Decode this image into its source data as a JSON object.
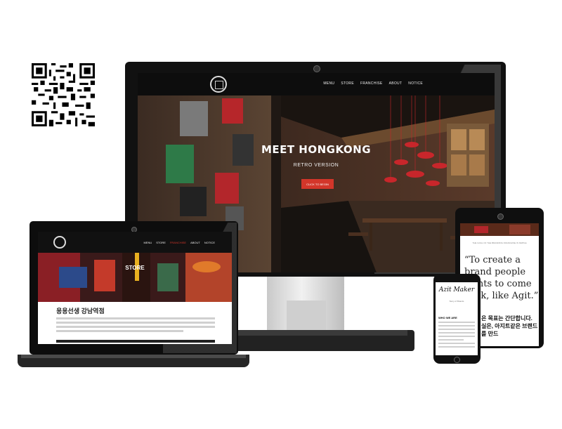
{
  "monitor": {
    "menu": [
      "MENU",
      "STORE",
      "FRANCHISE",
      "ABOUT",
      "NOTICE"
    ],
    "hero_title": "MEET HONGKONG",
    "hero_subtitle": "RETRO VERSION",
    "hero_button": "CLICK TO BEGIN"
  },
  "laptop": {
    "menu": [
      "MENU",
      "STORE",
      "FRANCHISE",
      "ABOUT",
      "NOTICE"
    ],
    "store_title": "STORE",
    "store_name": "용용선생 강남역점"
  },
  "tablet": {
    "small_text": "THE GOAL OF THE BRANDING FRANCHISE IS SIMPLE",
    "quote": "“To create a brand people wants to come back, like Agit.”",
    "korean": "은 목표는 간단합니다. 실은, 아지트같은 브랜드를 만드"
  },
  "phone": {
    "title": "Azit Maker",
    "subtitle": "Story of Brands",
    "who": "WHO WE ARE"
  },
  "colors": {
    "accent": "#d3362a",
    "frame": "#111111",
    "stand": "#c9c9c9"
  }
}
